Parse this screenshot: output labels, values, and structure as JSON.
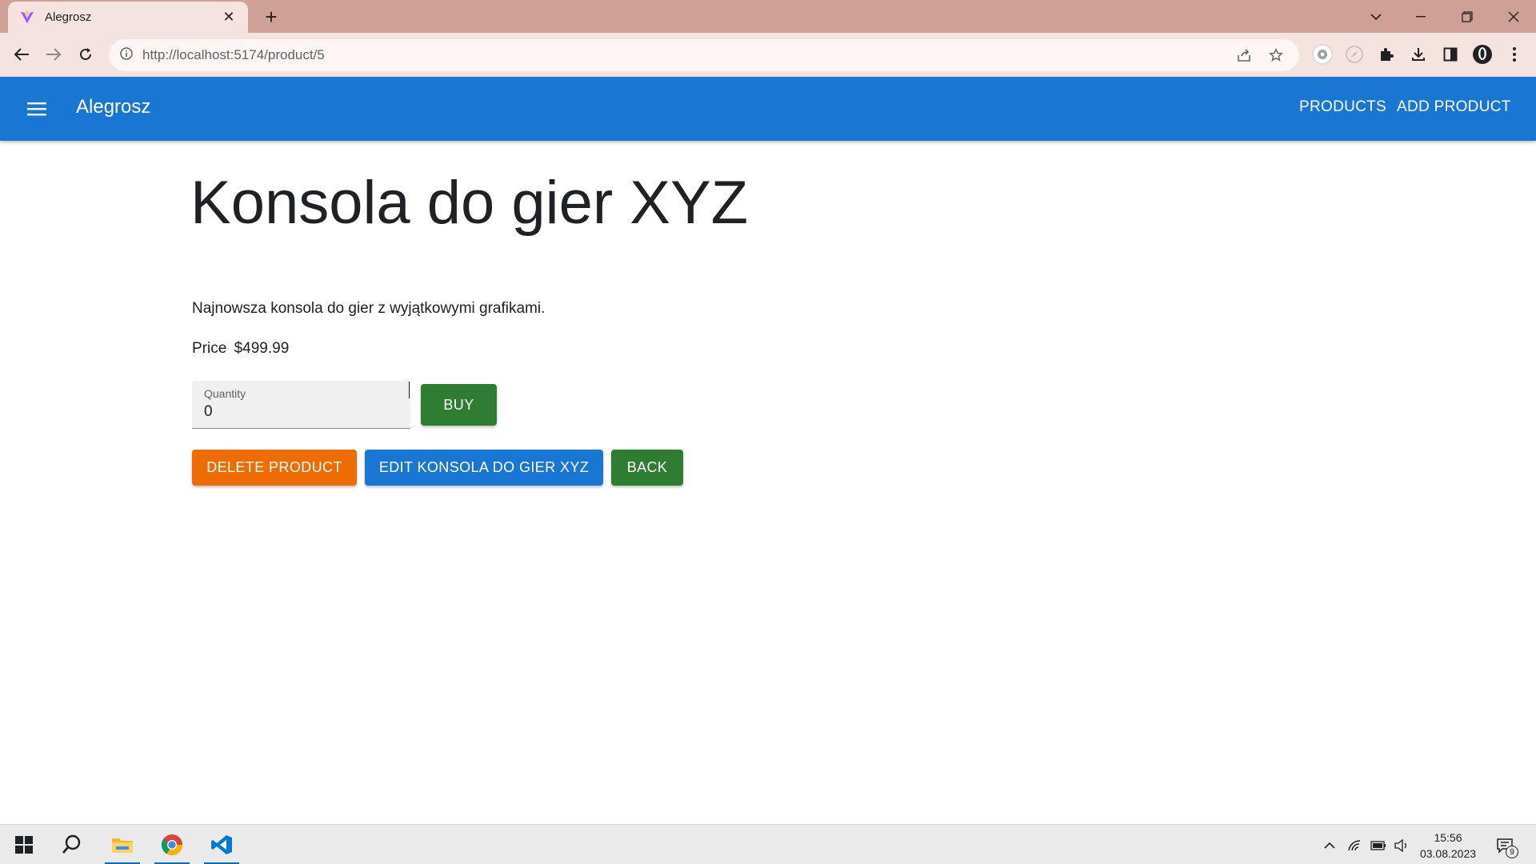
{
  "browser": {
    "tab_title": "Alegrosz",
    "url": "http://localhost:5174/product/5",
    "new_tab_symbol": "+"
  },
  "colors": {
    "appbar": "#1976d2",
    "buy": "#2e7d32",
    "delete": "#ef6c00",
    "edit": "#1976d2",
    "back": "#2e7d32"
  },
  "appbar": {
    "brand": "Alegrosz",
    "links": [
      "PRODUCTS",
      "ADD PRODUCT"
    ]
  },
  "product": {
    "title": "Konsola do gier XYZ",
    "description": "Najnowsza konsola do gier z wyjątkowymi grafikami.",
    "price_label": "Price",
    "price_value": "$499.99"
  },
  "quantity": {
    "label": "Quantity",
    "value": "0"
  },
  "buttons": {
    "buy": "BUY",
    "delete": "DELETE PRODUCT",
    "edit": "EDIT KONSOLA DO GIER XYZ",
    "back": "BACK"
  },
  "taskbar": {
    "time": "15:56",
    "date": "03.08.2023",
    "notification_count": "9"
  }
}
